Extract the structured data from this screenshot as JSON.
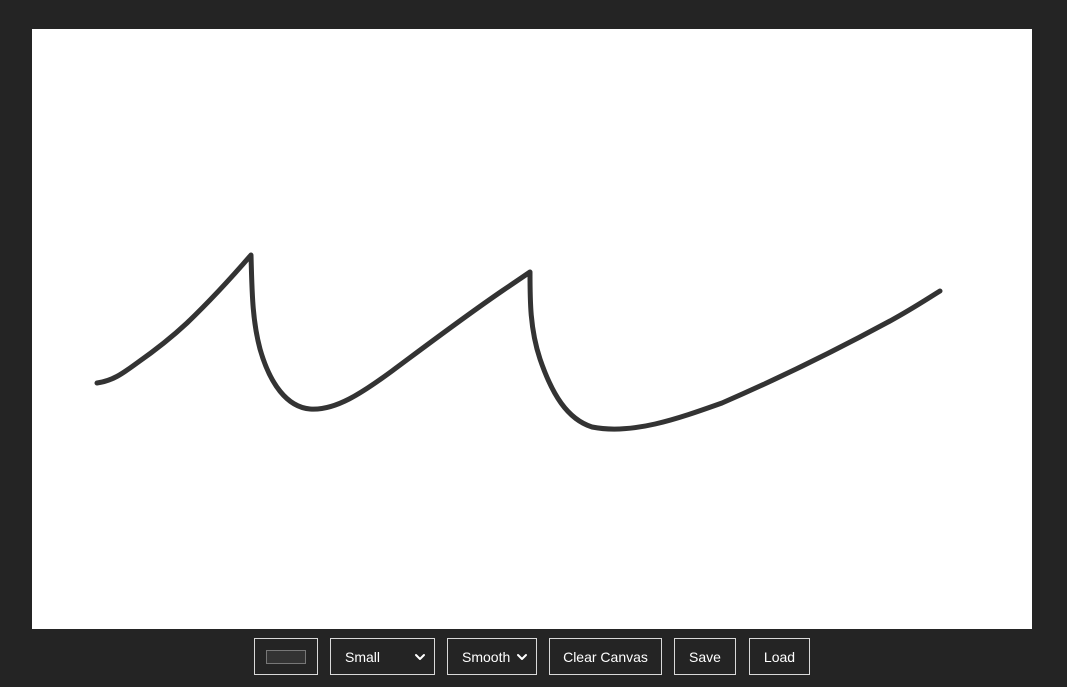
{
  "canvas": {
    "background": "#ffffff",
    "stroke_color": "#333333"
  },
  "toolbar": {
    "color_value": "#333333",
    "size_select": {
      "selected": "Small"
    },
    "brush_select": {
      "selected": "Smooth"
    },
    "clear_label": "Clear Canvas",
    "save_label": "Save",
    "load_label": "Load"
  },
  "icons": {
    "select_arrow": "chevron-down-icon"
  }
}
